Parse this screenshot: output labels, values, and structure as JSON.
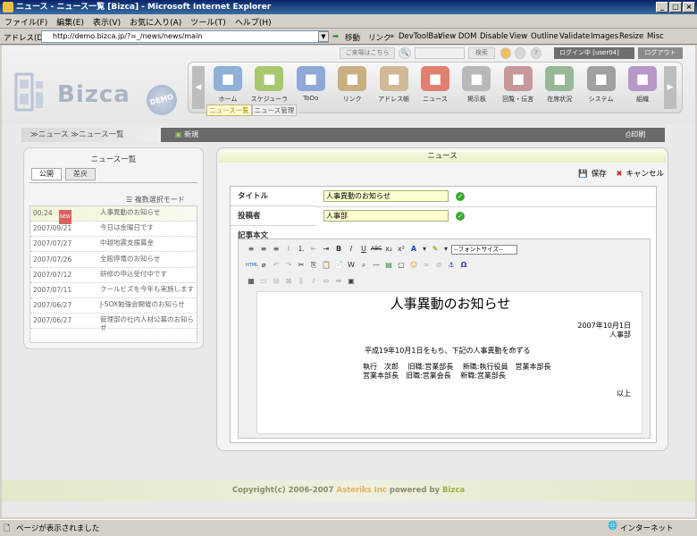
{
  "window": {
    "title": "ニュース - ニュース一覧 [Bizca] - Microsoft Internet Explorer"
  },
  "menu": [
    "ファイル(F)",
    "編集(E)",
    "表示(V)",
    "お気に入り(A)",
    "ツール(T)",
    "ヘルプ(H)"
  ],
  "address": {
    "label": "アドレス(D)",
    "url": "http://demo.bizca.jp/?=_/news/news/main",
    "go": "移動",
    "links": "リンク",
    "toolbar_items": [
      "DevToolBar",
      "View DOM",
      "Disable",
      "View",
      "Outline",
      "Validate",
      "Images",
      "Resize",
      "Misc"
    ]
  },
  "topinfo": {
    "visited": "ご来場はこちら",
    "search": "検索",
    "login": "ログイン中 [user04]",
    "logout": "ログアウト"
  },
  "logo": {
    "text": "Bizca",
    "badge": "DEMO"
  },
  "nav": [
    {
      "label": "ホーム",
      "icon": "home-icon",
      "color": "#8fb0d8"
    },
    {
      "label": "スケジューラ",
      "icon": "calendar-icon",
      "color": "#a8c870"
    },
    {
      "label": "ToDo",
      "icon": "todo-icon",
      "color": "#90a8d8"
    },
    {
      "label": "リンク",
      "icon": "link-icon",
      "color": "#c8b080"
    },
    {
      "label": "アドレス帳",
      "icon": "address-book-icon",
      "color": "#d0b898"
    },
    {
      "label": "ニュース",
      "icon": "news-icon",
      "color": "#e08070"
    },
    {
      "label": "掲示板",
      "icon": "board-icon",
      "color": "#b8b8b8"
    },
    {
      "label": "回覧・伝言",
      "icon": "message-icon",
      "color": "#c89898"
    },
    {
      "label": "在席状況",
      "icon": "status-icon",
      "color": "#98b898"
    },
    {
      "label": "システム",
      "icon": "system-icon",
      "color": "#a0a0a0"
    },
    {
      "label": "組織",
      "icon": "org-icon",
      "color": "#b898c8"
    }
  ],
  "subtabs": [
    "ニュース一覧",
    "ニュース管理"
  ],
  "crumb": {
    "path": "≫ニュース ≫ニュース一覧",
    "new": "新規",
    "print": "印刷"
  },
  "left": {
    "title": "ニュース一覧",
    "tabs": [
      "公開",
      "差戻"
    ],
    "mode": "複数選択モード",
    "items": [
      {
        "date": "00:24",
        "new": "NEW",
        "title": "人事異動のお知らせ"
      },
      {
        "date": "2007/09/21",
        "title": "今日は金曜日です"
      },
      {
        "date": "2007/07/27",
        "title": "中越地震支援募金"
      },
      {
        "date": "2007/07/26",
        "title": "全館停電のお知らせ"
      },
      {
        "date": "2007/07/12",
        "title": "研修の申込受付中です"
      },
      {
        "date": "2007/07/11",
        "title": "クールビズを今年も実施します"
      },
      {
        "date": "2007/06/27",
        "title": "J-SOX勉強会開催のお知らせ"
      },
      {
        "date": "2007/06/27",
        "title": "管理部の社内人材公募のお知らせ"
      }
    ]
  },
  "right": {
    "header": "ニュース",
    "save": "保存",
    "cancel": "キャンセル",
    "title_label": "タイトル",
    "title_value": "人事異動のお知らせ",
    "poster_label": "投稿者",
    "poster_value": "人事部",
    "body_label": "記事本文",
    "font_size": "--フォントサイズ--",
    "doc": {
      "title": "人事異動のお知らせ",
      "date": "2007年10月1日",
      "dept": "人事部",
      "intro": "平成19年10月1日をもち、下記の人事異動を命ずる",
      "line1": "執行　次郎　 旧職:営業部長　 新職:執行役員　営業本部長",
      "line2": "営業本部長　旧職:営業会長　 新職:営業部長",
      "end": "以上"
    }
  },
  "footer": {
    "pre": "Copyright(c) 2006-2007 ",
    "company": "Asteriks Inc",
    "mid": " powered by ",
    "brand": "Bizca"
  },
  "status": {
    "left": "ページが表示されました",
    "right": "インターネット"
  }
}
